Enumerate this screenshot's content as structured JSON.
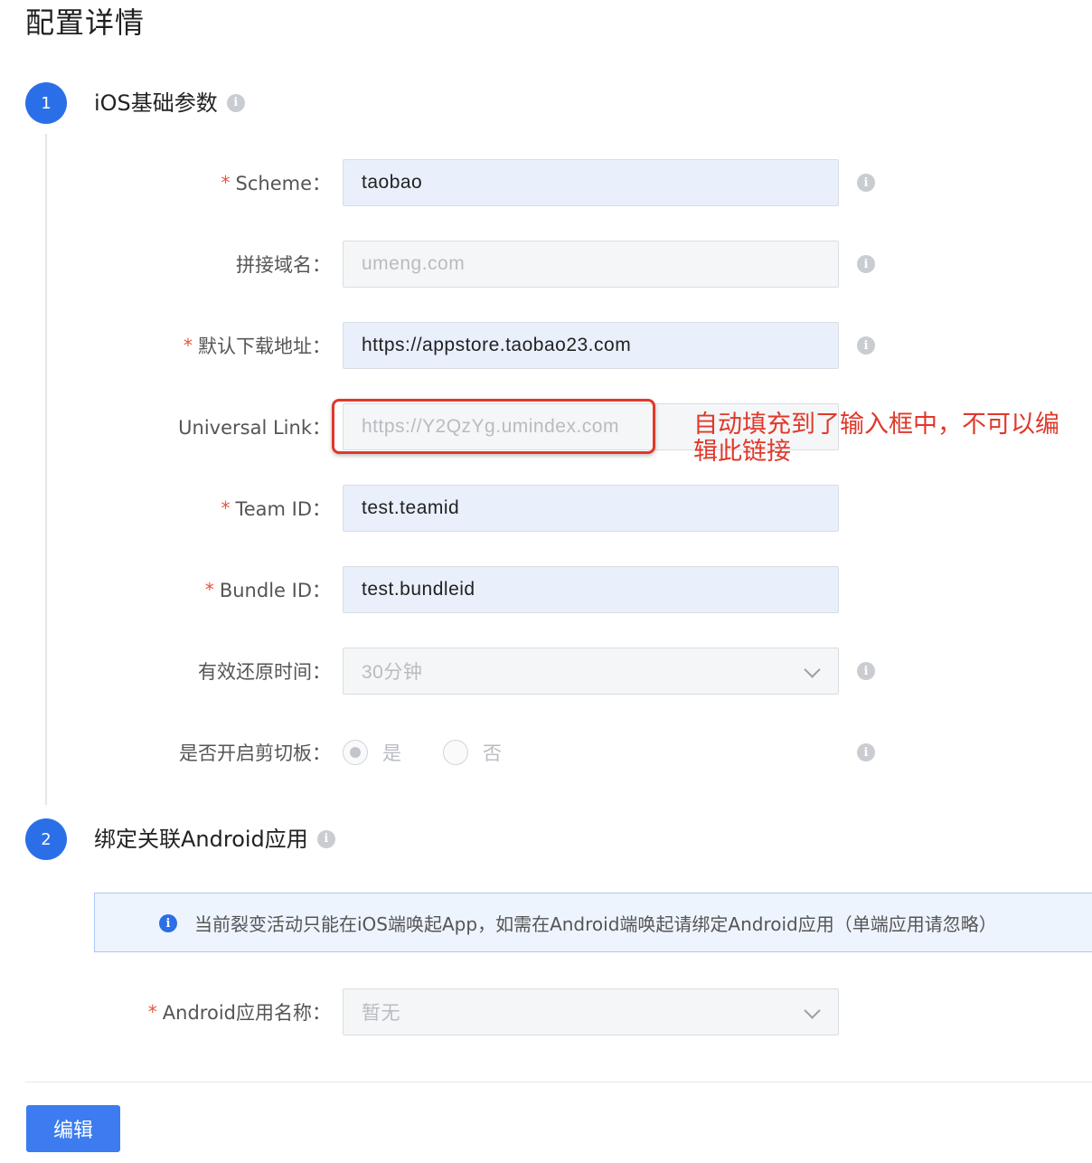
{
  "page_title": "配置详情",
  "steps": [
    {
      "number": "1",
      "title": "iOS基础参数"
    },
    {
      "number": "2",
      "title": "绑定关联Android应用"
    }
  ],
  "form": {
    "scheme": {
      "label": "Scheme：",
      "value": "taobao",
      "required": "*"
    },
    "domain": {
      "label": "拼接域名：",
      "value": "umeng.com"
    },
    "download_url": {
      "label": "默认下载地址：",
      "value": "https://appstore.taobao23.com",
      "required": "*"
    },
    "universal_link": {
      "label": "Universal Link：",
      "value": "https://Y2QzYg.umindex.com"
    },
    "team_id": {
      "label": "Team ID：",
      "value": "test.teamid",
      "required": "*"
    },
    "bundle_id": {
      "label": "Bundle ID：",
      "value": "test.bundleid",
      "required": "*"
    },
    "restore_time": {
      "label": "有效还原时间：",
      "value": "30分钟"
    },
    "clipboard": {
      "label": "是否开启剪切板：",
      "option_yes": "是",
      "option_no": "否",
      "selected": "是"
    },
    "android_app": {
      "label": "Android应用名称：",
      "value": "暂无",
      "required": "*"
    }
  },
  "annotation": "自动填充到了输入框中，不可以编辑此链接",
  "notice": "当前裂变活动只能在iOS端唤起App，如需在Android端唤起请绑定Android应用（单端应用请忽略）",
  "edit_button": "编辑",
  "icons": {
    "info": "i"
  },
  "colors": {
    "primary": "#2b6fe8",
    "annotation": "#e0382b",
    "required": "#e8543d"
  }
}
